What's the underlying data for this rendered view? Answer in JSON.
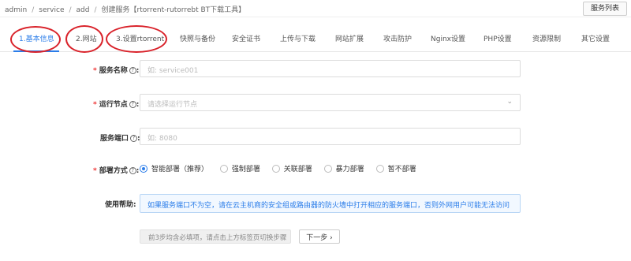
{
  "breadcrumb": [
    {
      "label": "admin"
    },
    {
      "label": "service"
    },
    {
      "label": "add"
    },
    {
      "label": "创建服务【rtorrent-rutorrebt BT下载工具】"
    }
  ],
  "breadcrumb_separator": "/",
  "service_list_button": "服务列表",
  "tabs": [
    {
      "label": "1.基本信息"
    },
    {
      "label": "2.网站"
    },
    {
      "label": "3.设置rtorrent"
    },
    {
      "label": "快照与备份"
    },
    {
      "label": "安全证书"
    },
    {
      "label": "上传与下载"
    },
    {
      "label": "网站扩展"
    },
    {
      "label": "攻击防护"
    },
    {
      "label": "Nginx设置"
    },
    {
      "label": "PHP设置"
    },
    {
      "label": "资源限制"
    },
    {
      "label": "其它设置"
    }
  ],
  "required_mark": "*",
  "help_mark": "?",
  "form": {
    "service_name": {
      "label": "服务名称",
      "placeholder": "如: service001"
    },
    "run_node": {
      "label": "运行节点",
      "placeholder": "请选择运行节点"
    },
    "service_port": {
      "label": "服务端口",
      "placeholder": "如: 8080"
    },
    "deploy_mode": {
      "label": "部署方式",
      "options": [
        {
          "label": "智能部署（推荐）",
          "checked": true
        },
        {
          "label": "强制部署",
          "checked": false
        },
        {
          "label": "关联部署",
          "checked": false
        },
        {
          "label": "暴力部署",
          "checked": false
        },
        {
          "label": "暂不部署",
          "checked": false
        }
      ]
    },
    "help": {
      "label": "使用帮助:",
      "text": "如果服务端口不为空，请在云主机商的安全组或路由器的防火墙中打开相应的服务端口，否则外网用户可能无法访问"
    }
  },
  "footer": {
    "tip": "前3步均含必填项，请点击上方标签页切换步骤",
    "next_button": "下一步 ›"
  },
  "colors": {
    "accent": "#2b7de9",
    "annotation_circle": "#d9222a",
    "required": "#ee3333"
  }
}
